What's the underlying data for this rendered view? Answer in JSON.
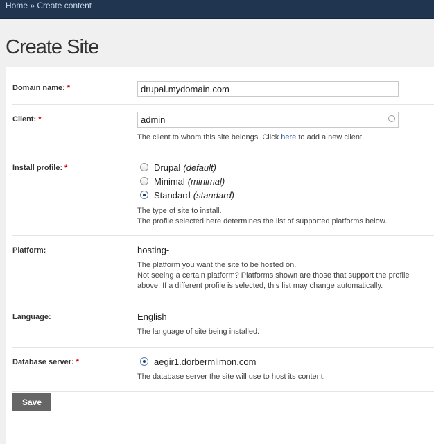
{
  "breadcrumb": {
    "home": "Home",
    "separator": " » ",
    "current": "Create content"
  },
  "page_title": "Create Site",
  "required_marker": "*",
  "fields": {
    "domain": {
      "label": "Domain name:",
      "value": "drupal.mydomain.com"
    },
    "client": {
      "label": "Client:",
      "value": "admin",
      "desc_before": "The client to whom this site belongs. Click ",
      "desc_link": "here",
      "desc_after": " to add a new client."
    },
    "profile": {
      "label": "Install profile:",
      "options": [
        {
          "name": "Drupal",
          "machine": "(default)",
          "checked": false
        },
        {
          "name": "Minimal",
          "machine": "(minimal)",
          "checked": false
        },
        {
          "name": "Standard",
          "machine": "(standard)",
          "checked": true
        }
      ],
      "desc_line1": "The type of site to install.",
      "desc_line2": "The profile selected here determines the list of supported platforms below."
    },
    "platform": {
      "label": "Platform:",
      "value": "hosting-",
      "desc_line1": "The platform you want the site to be hosted on.",
      "desc_line2": "Not seeing a certain platform? Platforms shown are those that support the profile above. If a different profile is selected, this list may change automatically."
    },
    "language": {
      "label": "Language:",
      "value": "English",
      "desc": "The language of site being installed."
    },
    "db_server": {
      "label": "Database server:",
      "value": "aegir1.dorbermlimon.com",
      "desc": "The database server the site will use to host its content."
    }
  },
  "save_label": "Save"
}
